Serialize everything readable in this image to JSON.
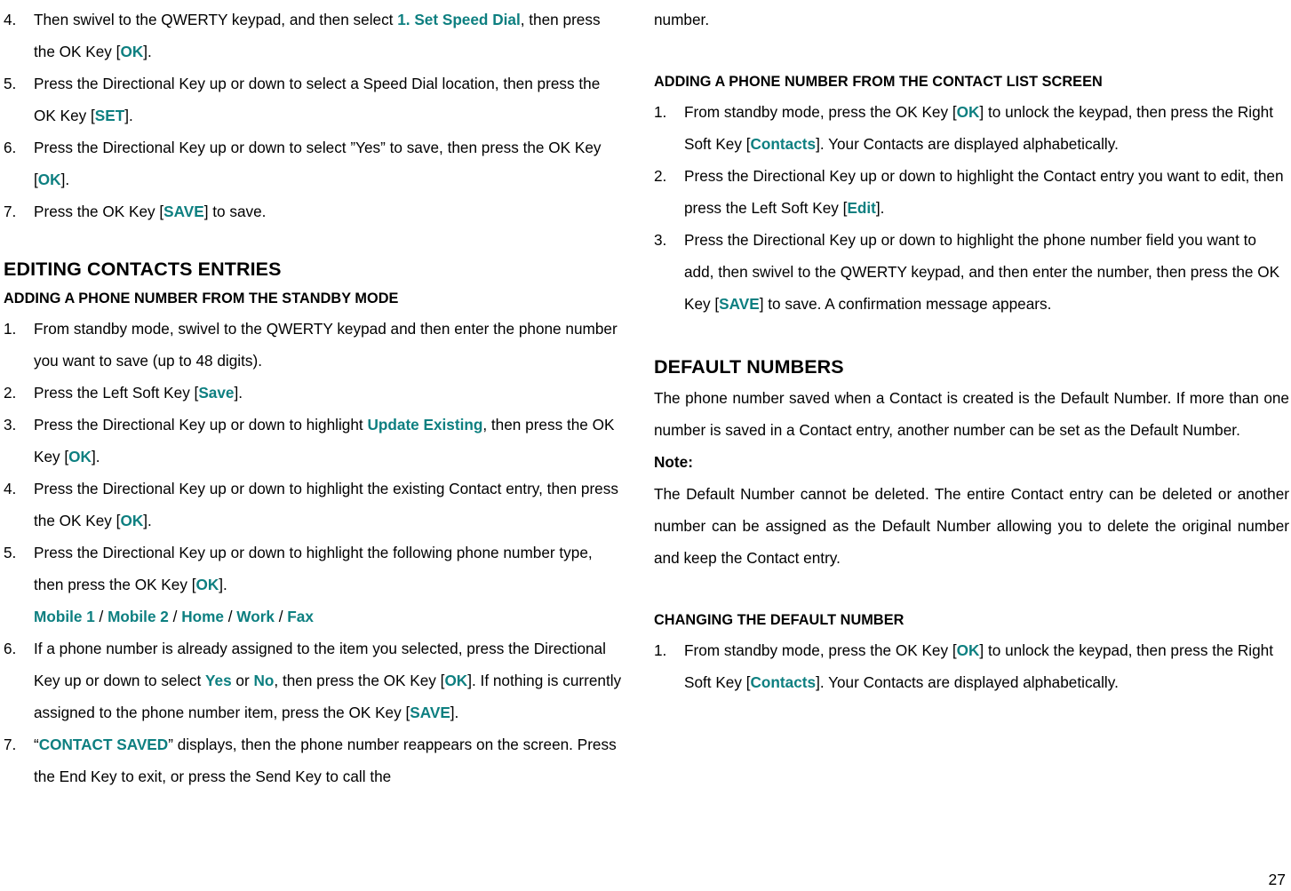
{
  "page": {
    "number": "27",
    "accent_color": "#0d7f80",
    "text_color": "#000000",
    "background_color": "#ffffff"
  },
  "left_column": {
    "continued_list": {
      "items": [
        {
          "num": "4.",
          "parts": [
            {
              "t": "Then swivel to the QWERTY keypad, and then select ",
              "k": false
            },
            {
              "t": "1. Set Speed Dial",
              "k": true
            },
            {
              "t": ", then press the OK Key [",
              "k": false
            },
            {
              "t": "OK",
              "k": true
            },
            {
              "t": "].",
              "k": false
            }
          ]
        },
        {
          "num": "5.",
          "parts": [
            {
              "t": "Press the Directional Key up or down to select a Speed Dial location, then press the OK Key [",
              "k": false
            },
            {
              "t": "SET",
              "k": true
            },
            {
              "t": "].",
              "k": false
            }
          ]
        },
        {
          "num": "6.",
          "parts": [
            {
              "t": "Press the Directional Key up or down to select ”Yes” to save, then press the OK Key [",
              "k": false
            },
            {
              "t": "OK",
              "k": true
            },
            {
              "t": "].",
              "k": false
            }
          ]
        },
        {
          "num": "7.",
          "parts": [
            {
              "t": "Press the OK Key [",
              "k": false
            },
            {
              "t": "SAVE",
              "k": true
            },
            {
              "t": "] to save.",
              "k": false
            }
          ]
        }
      ]
    },
    "section_heading": "EDITING CONTACTS ENTRIES",
    "sub_heading": "ADDING A PHONE NUMBER FROM THE STANDBY MODE",
    "steps": [
      {
        "num": "1.",
        "parts": [
          {
            "t": "From standby mode, swivel to the QWERTY keypad and then enter the phone number you want to save (up to 48 digits).",
            "k": false
          }
        ]
      },
      {
        "num": "2.",
        "parts": [
          {
            "t": "Press the Left Soft Key [",
            "k": false
          },
          {
            "t": "Save",
            "k": true
          },
          {
            "t": "].",
            "k": false
          }
        ]
      },
      {
        "num": "3.",
        "parts": [
          {
            "t": "Press the Directional Key up or down to highlight ",
            "k": false
          },
          {
            "t": "Update Existing",
            "k": true
          },
          {
            "t": ", then press the OK Key [",
            "k": false
          },
          {
            "t": "OK",
            "k": true
          },
          {
            "t": "].",
            "k": false
          }
        ]
      },
      {
        "num": "4.",
        "parts": [
          {
            "t": "Press the Directional Key up or down to highlight the existing Contact entry, then press the OK Key [",
            "k": false
          },
          {
            "t": "OK",
            "k": true
          },
          {
            "t": "].",
            "k": false
          }
        ]
      },
      {
        "num": "5.",
        "parts": [
          {
            "t": "Press the Directional Key up or down to highlight the following phone number type, then press the OK Key [",
            "k": false
          },
          {
            "t": "OK",
            "k": true
          },
          {
            "t": "].",
            "k": false
          }
        ],
        "types": [
          "Mobile 1",
          "Mobile 2",
          "Home",
          "Work",
          "Fax"
        ],
        "types_separator": " / "
      },
      {
        "num": "6.",
        "parts": [
          {
            "t": "If a phone number is already assigned to the item you selected, press the Directional Key up or down to select ",
            "k": false
          },
          {
            "t": "Yes",
            "k": true
          },
          {
            "t": " or ",
            "k": false
          },
          {
            "t": "No",
            "k": true
          },
          {
            "t": ", then press the OK Key [",
            "k": false
          },
          {
            "t": "OK",
            "k": true
          },
          {
            "t": "]. If nothing is currently assigned to the phone number item, press the OK Key [",
            "k": false
          },
          {
            "t": "SAVE",
            "k": true
          },
          {
            "t": "].",
            "k": false
          }
        ]
      },
      {
        "num": "7.",
        "parts": [
          {
            "t": "“",
            "k": false
          },
          {
            "t": "CONTACT SAVED",
            "k": true
          },
          {
            "t": "” displays, then the phone number reappears on the screen. Press the End Key to exit, or press the Send Key to call the",
            "k": false
          }
        ]
      }
    ]
  },
  "right_column": {
    "continuation_text": "number.",
    "sub_heading_1": "ADDING A PHONE NUMBER FROM THE CONTACT LIST SCREEN",
    "steps_1": [
      {
        "num": "1.",
        "parts": [
          {
            "t": "From standby mode, press the OK Key [",
            "k": false
          },
          {
            "t": "OK",
            "k": true
          },
          {
            "t": "] to unlock the keypad, then press the Right Soft Key [",
            "k": false
          },
          {
            "t": "Contacts",
            "k": true
          },
          {
            "t": "]. Your Contacts are displayed alphabetically.",
            "k": false
          }
        ]
      },
      {
        "num": "2.",
        "parts": [
          {
            "t": "Press the Directional Key up or down to highlight the Contact entry you want to edit, then press the Left Soft Key [",
            "k": false
          },
          {
            "t": "Edit",
            "k": true
          },
          {
            "t": "].",
            "k": false
          }
        ]
      },
      {
        "num": "3.",
        "parts": [
          {
            "t": "Press the Directional Key up or down to highlight the phone number field you want to add, then swivel to the QWERTY keypad, and then enter the number, then press the OK Key [",
            "k": false
          },
          {
            "t": "SAVE",
            "k": true
          },
          {
            "t": "] to save. A confirmation message appears.",
            "k": false
          }
        ]
      }
    ],
    "section_heading": "DEFAULT NUMBERS",
    "body_paragraph": "The phone number saved when a Contact is created is the Default Number. If more than one number is saved in a Contact entry, another number can be set as the Default Number.",
    "note_label": "Note:",
    "note_body": "The Default Number cannot be deleted. The entire Contact entry can be deleted or another number can be assigned as the Default Number allowing you to delete the original number and keep the Contact entry.",
    "sub_heading_2": "CHANGING THE DEFAULT NUMBER",
    "steps_2": [
      {
        "num": "1.",
        "parts": [
          {
            "t": "From standby mode, press the OK Key [",
            "k": false
          },
          {
            "t": "OK",
            "k": true
          },
          {
            "t": "] to unlock the keypad, then press the Right Soft Key [",
            "k": false
          },
          {
            "t": "Contacts",
            "k": true
          },
          {
            "t": "]. Your Contacts are displayed alphabetically.",
            "k": false
          }
        ]
      }
    ]
  }
}
